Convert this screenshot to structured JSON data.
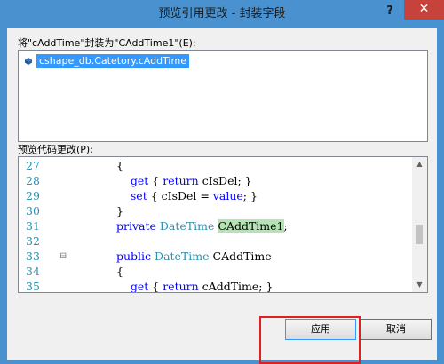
{
  "window": {
    "title": "预览引用更改 - 封装字段",
    "help": "?",
    "close": "✕"
  },
  "references": {
    "label": "将\"cAddTime\"封装为\"CAddTime1\"(E):",
    "items": [
      {
        "text": "cshape_db.Catetory.cAddTime",
        "icon": "field-icon"
      }
    ]
  },
  "preview": {
    "label": "预览代码更改(P):",
    "lines": [
      {
        "num": "27",
        "fold": "",
        "parts": [
          {
            "t": "{",
            "c": ""
          }
        ]
      },
      {
        "num": "28",
        "fold": "",
        "parts": [
          {
            "t": "    get",
            "c": "kw"
          },
          {
            "t": " { ",
            "c": ""
          },
          {
            "t": "return",
            "c": "kw"
          },
          {
            "t": " cIsDel; }",
            "c": ""
          }
        ]
      },
      {
        "num": "29",
        "fold": "",
        "parts": [
          {
            "t": "    set",
            "c": "kw"
          },
          {
            "t": " { cIsDel = ",
            "c": ""
          },
          {
            "t": "value",
            "c": "kw"
          },
          {
            "t": "; }",
            "c": ""
          }
        ]
      },
      {
        "num": "30",
        "fold": "",
        "parts": [
          {
            "t": "}",
            "c": ""
          }
        ]
      },
      {
        "num": "31",
        "fold": "",
        "parts": [
          {
            "t": "private",
            "c": "kw"
          },
          {
            "t": " ",
            "c": ""
          },
          {
            "t": "DateTime",
            "c": "ty"
          },
          {
            "t": " ",
            "c": ""
          },
          {
            "t": "CAddTime1",
            "c": "hl"
          },
          {
            "t": ";",
            "c": ""
          }
        ]
      },
      {
        "num": "32",
        "fold": "",
        "parts": []
      },
      {
        "num": "33",
        "fold": "⊟",
        "parts": [
          {
            "t": "public",
            "c": "kw"
          },
          {
            "t": " ",
            "c": ""
          },
          {
            "t": "DateTime",
            "c": "ty"
          },
          {
            "t": " CAddTime",
            "c": ""
          }
        ]
      },
      {
        "num": "34",
        "fold": "",
        "parts": [
          {
            "t": "{",
            "c": ""
          }
        ]
      },
      {
        "num": "35",
        "fold": "",
        "parts": [
          {
            "t": "    get",
            "c": "kw"
          },
          {
            "t": " { ",
            "c": ""
          },
          {
            "t": "return",
            "c": "kw"
          },
          {
            "t": " cAddTime; }",
            "c": ""
          }
        ]
      }
    ]
  },
  "buttons": {
    "apply": "应用",
    "cancel": "取消"
  },
  "colors": {
    "titlebar": "#4a92cf",
    "close": "#c7423b",
    "selection": "#3399ff",
    "keyword": "#0000ff",
    "type": "#2b91af",
    "highlight": "#b4e3b4",
    "annotation": "#e02020"
  }
}
